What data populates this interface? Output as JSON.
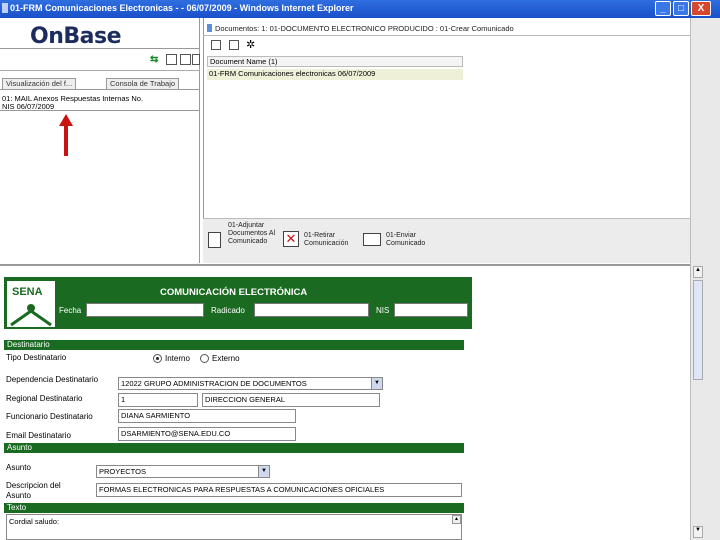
{
  "window": {
    "title": "01-FRM Comunicaciones Electronicas - - 06/07/2009 - Windows Internet Explorer",
    "min_label": "_",
    "max_label": "□",
    "close_label": "X"
  },
  "left_pane": {
    "logo": "OnBase",
    "tabs": [
      "Visualización del f...",
      "Consola de Trabajo"
    ],
    "columns_line1": "01: MAIL Anexos Respuestas Internas  No.",
    "columns_line2": "NIS    06/07/2009"
  },
  "right_pane": {
    "breadcrumb": "Documentos: 1: 01-DOCUMENTO ELECTRONICO PRODUCIDO : 01-Crear Comunicado",
    "list_header": "Document Name (1)",
    "document_row": "01-FRM Comunicaciones electronicas    06/07/2009",
    "actions": [
      {
        "label": "01-Adjuntar Documentos Al Comunicado"
      },
      {
        "label": "01-Retirar Comunicación"
      },
      {
        "label": "01-Enviar Comunicado"
      }
    ]
  },
  "form": {
    "title": "COMUNICACIÓN ELECTRÓNICA",
    "logo_text": "SENA",
    "fecha_label": "Fecha",
    "radicado_label": "Radicado",
    "nis_label": "NIS",
    "destinatario_header": "Destinatario",
    "tipo_label": "Tipo Destinatario",
    "radio_interno": "Interno",
    "radio_externo": "Externo",
    "dependencia_label": "Dependencia Destinatario",
    "dependencia_value": "12022   GRUPO ADMINISTRACION DE DOCUMENTOS",
    "regional_label": "Regional Destinatario",
    "regional_code": "1",
    "regional_value": "DIRECCION GENERAL",
    "funcionario_label": "Funcionario Destinatario",
    "funcionario_value": "DIANA SARMIENTO",
    "email_label": "Email Destinatario",
    "email_value": "DSARMIENTO@SENA.EDU.CO",
    "asunto_header": "Asunto",
    "asunto_label": "Asunto",
    "asunto_value": "PROYECTOS",
    "descripcion_label_1": "Descripcion del",
    "descripcion_label_2": "Asunto",
    "descripcion_value": "FORMAS ELECTRONICAS PARA RESPUESTAS A COMUNICACIONES OFICIALES",
    "texto_header": "Texto",
    "texto_value": "Cordial saludo:"
  },
  "colors": {
    "title_bar": "#1a4fc8",
    "form_green": "#1a6b21",
    "arrow_red": "#cc1111"
  }
}
